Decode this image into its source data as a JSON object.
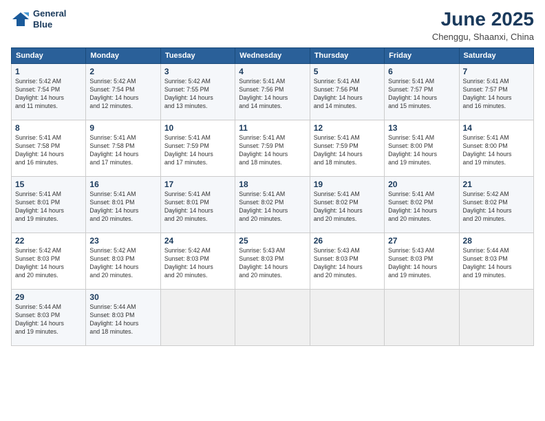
{
  "logo": {
    "line1": "General",
    "line2": "Blue"
  },
  "title": "June 2025",
  "location": "Chenggu, Shaanxi, China",
  "days_of_week": [
    "Sunday",
    "Monday",
    "Tuesday",
    "Wednesday",
    "Thursday",
    "Friday",
    "Saturday"
  ],
  "weeks": [
    [
      {
        "day": "1",
        "info": "Sunrise: 5:42 AM\nSunset: 7:54 PM\nDaylight: 14 hours\nand 11 minutes."
      },
      {
        "day": "2",
        "info": "Sunrise: 5:42 AM\nSunset: 7:54 PM\nDaylight: 14 hours\nand 12 minutes."
      },
      {
        "day": "3",
        "info": "Sunrise: 5:42 AM\nSunset: 7:55 PM\nDaylight: 14 hours\nand 13 minutes."
      },
      {
        "day": "4",
        "info": "Sunrise: 5:41 AM\nSunset: 7:56 PM\nDaylight: 14 hours\nand 14 minutes."
      },
      {
        "day": "5",
        "info": "Sunrise: 5:41 AM\nSunset: 7:56 PM\nDaylight: 14 hours\nand 14 minutes."
      },
      {
        "day": "6",
        "info": "Sunrise: 5:41 AM\nSunset: 7:57 PM\nDaylight: 14 hours\nand 15 minutes."
      },
      {
        "day": "7",
        "info": "Sunrise: 5:41 AM\nSunset: 7:57 PM\nDaylight: 14 hours\nand 16 minutes."
      }
    ],
    [
      {
        "day": "8",
        "info": "Sunrise: 5:41 AM\nSunset: 7:58 PM\nDaylight: 14 hours\nand 16 minutes."
      },
      {
        "day": "9",
        "info": "Sunrise: 5:41 AM\nSunset: 7:58 PM\nDaylight: 14 hours\nand 17 minutes."
      },
      {
        "day": "10",
        "info": "Sunrise: 5:41 AM\nSunset: 7:59 PM\nDaylight: 14 hours\nand 17 minutes."
      },
      {
        "day": "11",
        "info": "Sunrise: 5:41 AM\nSunset: 7:59 PM\nDaylight: 14 hours\nand 18 minutes."
      },
      {
        "day": "12",
        "info": "Sunrise: 5:41 AM\nSunset: 7:59 PM\nDaylight: 14 hours\nand 18 minutes."
      },
      {
        "day": "13",
        "info": "Sunrise: 5:41 AM\nSunset: 8:00 PM\nDaylight: 14 hours\nand 19 minutes."
      },
      {
        "day": "14",
        "info": "Sunrise: 5:41 AM\nSunset: 8:00 PM\nDaylight: 14 hours\nand 19 minutes."
      }
    ],
    [
      {
        "day": "15",
        "info": "Sunrise: 5:41 AM\nSunset: 8:01 PM\nDaylight: 14 hours\nand 19 minutes."
      },
      {
        "day": "16",
        "info": "Sunrise: 5:41 AM\nSunset: 8:01 PM\nDaylight: 14 hours\nand 20 minutes."
      },
      {
        "day": "17",
        "info": "Sunrise: 5:41 AM\nSunset: 8:01 PM\nDaylight: 14 hours\nand 20 minutes."
      },
      {
        "day": "18",
        "info": "Sunrise: 5:41 AM\nSunset: 8:02 PM\nDaylight: 14 hours\nand 20 minutes."
      },
      {
        "day": "19",
        "info": "Sunrise: 5:41 AM\nSunset: 8:02 PM\nDaylight: 14 hours\nand 20 minutes."
      },
      {
        "day": "20",
        "info": "Sunrise: 5:41 AM\nSunset: 8:02 PM\nDaylight: 14 hours\nand 20 minutes."
      },
      {
        "day": "21",
        "info": "Sunrise: 5:42 AM\nSunset: 8:02 PM\nDaylight: 14 hours\nand 20 minutes."
      }
    ],
    [
      {
        "day": "22",
        "info": "Sunrise: 5:42 AM\nSunset: 8:03 PM\nDaylight: 14 hours\nand 20 minutes."
      },
      {
        "day": "23",
        "info": "Sunrise: 5:42 AM\nSunset: 8:03 PM\nDaylight: 14 hours\nand 20 minutes."
      },
      {
        "day": "24",
        "info": "Sunrise: 5:42 AM\nSunset: 8:03 PM\nDaylight: 14 hours\nand 20 minutes."
      },
      {
        "day": "25",
        "info": "Sunrise: 5:43 AM\nSunset: 8:03 PM\nDaylight: 14 hours\nand 20 minutes."
      },
      {
        "day": "26",
        "info": "Sunrise: 5:43 AM\nSunset: 8:03 PM\nDaylight: 14 hours\nand 20 minutes."
      },
      {
        "day": "27",
        "info": "Sunrise: 5:43 AM\nSunset: 8:03 PM\nDaylight: 14 hours\nand 19 minutes."
      },
      {
        "day": "28",
        "info": "Sunrise: 5:44 AM\nSunset: 8:03 PM\nDaylight: 14 hours\nand 19 minutes."
      }
    ],
    [
      {
        "day": "29",
        "info": "Sunrise: 5:44 AM\nSunset: 8:03 PM\nDaylight: 14 hours\nand 19 minutes."
      },
      {
        "day": "30",
        "info": "Sunrise: 5:44 AM\nSunset: 8:03 PM\nDaylight: 14 hours\nand 18 minutes."
      },
      {
        "day": "",
        "info": ""
      },
      {
        "day": "",
        "info": ""
      },
      {
        "day": "",
        "info": ""
      },
      {
        "day": "",
        "info": ""
      },
      {
        "day": "",
        "info": ""
      }
    ]
  ]
}
